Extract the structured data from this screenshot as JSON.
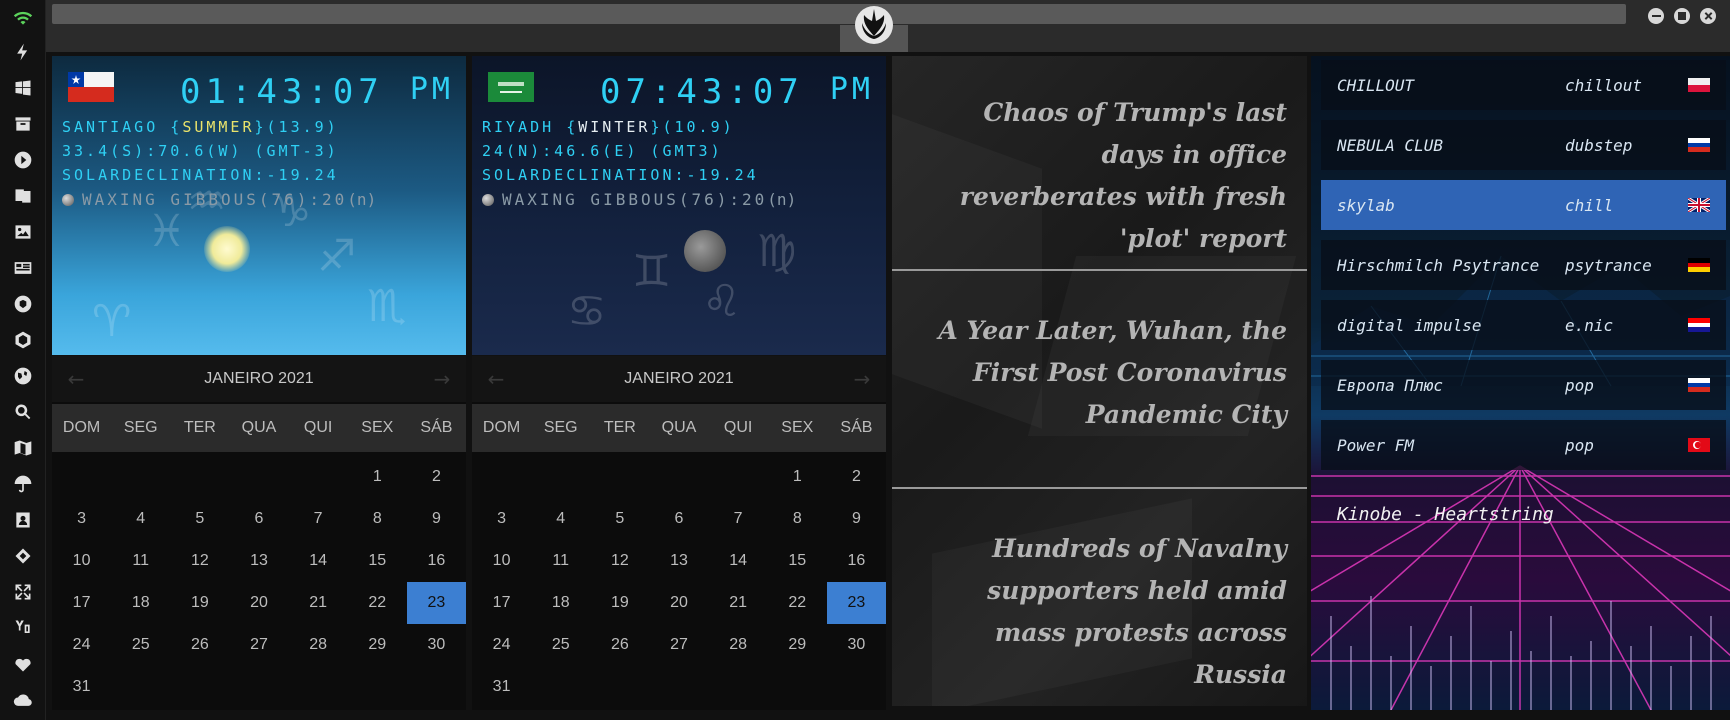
{
  "sidebar": {
    "icons": [
      "wifi-icon",
      "lightning-icon",
      "windows-icon",
      "archive-icon",
      "play-icon",
      "translate-icon",
      "image-icon",
      "news-icon",
      "aperture-icon",
      "hexagon-icon",
      "globe-icon",
      "search-icon",
      "map-icon",
      "umbrella-icon",
      "contact-icon",
      "tag-icon",
      "expand-icon",
      "youtube-icon",
      "heart-icon",
      "cloud-icon"
    ]
  },
  "clocks": [
    {
      "flag": "chile-flag",
      "time": "01:43:07",
      "ampm": "PM",
      "city": "SANTIAGO {",
      "season": "SUMMER",
      "temp": "}(13.9)",
      "coords": "33.4(S):70.6(W) (GMT-3)",
      "solar": "SOLARDECLINATION:-19.24",
      "moon_phase": "WAXING GIBBOUS(76):20",
      "moon_suffix": "(n)"
    },
    {
      "flag": "saudi-flag",
      "time": "07:43:07",
      "ampm": "PM",
      "city": "RIYADH {",
      "season": "WINTER",
      "temp": "}(10.9)",
      "coords": "24(N):46.6(E) (GMT3)",
      "solar": "SOLARDECLINATION:-19.24",
      "moon_phase": "WAXING GIBBOUS(76):20",
      "moon_suffix": "(n)"
    }
  ],
  "calendars": [
    {
      "month": "JANEIRO 2021",
      "prev": "←",
      "next": "→"
    },
    {
      "month": "JANEIRO 2021",
      "prev": "←",
      "next": "→"
    }
  ],
  "calendar_days_of_week": [
    "DOM",
    "SEG",
    "TER",
    "QUA",
    "QUI",
    "SEX",
    "SÁB"
  ],
  "calendar_weeks": [
    [
      "",
      "",
      "",
      "",
      "",
      "1",
      "2"
    ],
    [
      "3",
      "4",
      "5",
      "6",
      "7",
      "8",
      "9"
    ],
    [
      "10",
      "11",
      "12",
      "13",
      "14",
      "15",
      "16"
    ],
    [
      "17",
      "18",
      "19",
      "20",
      "21",
      "22",
      "23"
    ],
    [
      "24",
      "25",
      "26",
      "27",
      "28",
      "29",
      "30"
    ],
    [
      "31",
      "",
      "",
      "",
      "",
      "",
      ""
    ]
  ],
  "calendar_today": "23",
  "colors": {
    "accent": "#3c7fd2",
    "clock_text": "#2fd0f4",
    "season_text": "#e9e36b"
  },
  "news": [
    {
      "headline": "Chaos of Trump's last days in office reverberates with fresh 'plot' report"
    },
    {
      "headline": "A Year Later, Wuhan, the First Post Coronavirus Pandemic City"
    },
    {
      "headline": "Hundreds of Navalny supporters held amid mass protests across Russia"
    }
  ],
  "radio": {
    "stations": [
      {
        "name": "CHILLOUT",
        "genre": "chillout",
        "flag": "poland-flag"
      },
      {
        "name": "NEBULA CLUB",
        "genre": "dubstep",
        "flag": "russia-flag"
      },
      {
        "name": "skylab",
        "genre": "chill",
        "flag": "uk-flag"
      },
      {
        "name": "Hirschmilch Psytrance",
        "genre": "psytrance",
        "flag": "germany-flag"
      },
      {
        "name": "digital impulse",
        "genre": "e.nic",
        "flag": "croatia-flag"
      },
      {
        "name": "Европа Плюс",
        "genre": "pop",
        "flag": "russia-flag"
      },
      {
        "name": "Power FM",
        "genre": "pop",
        "flag": "turkey-flag"
      }
    ],
    "active_station": "skylab",
    "now_playing": "Kinobe - Heartstring"
  }
}
